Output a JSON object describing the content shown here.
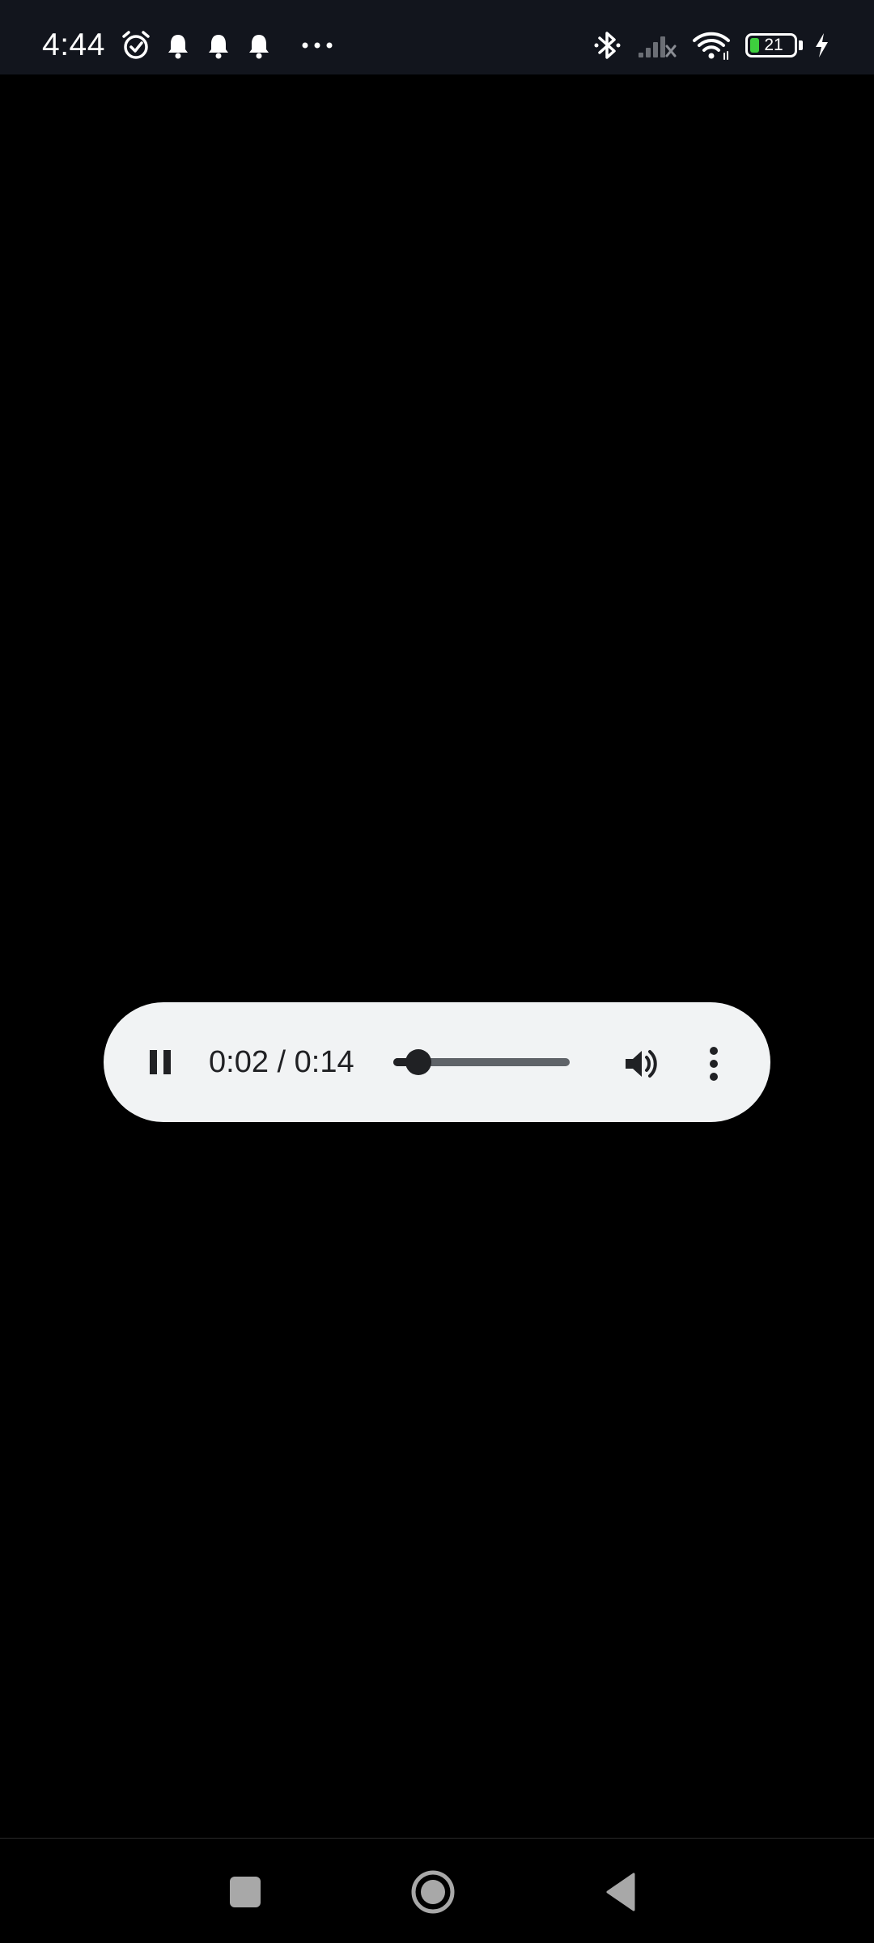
{
  "status_bar": {
    "time": "4:44",
    "left_icons": [
      "alarm-icon",
      "notification-bell-icon",
      "notification-bell-icon",
      "notification-bell-icon",
      "more-notifications-icon"
    ],
    "right_icons": [
      "bluetooth-icon",
      "cellular-no-signal-icon",
      "wifi-icon",
      "battery-icon",
      "charging-icon"
    ],
    "battery_level": "21",
    "battery_fraction": 0.21,
    "battery_color": "#3ecf3e"
  },
  "player": {
    "state": "playing",
    "time_display": "0:02 / 0:14",
    "progress_fraction": 0.143,
    "background_color": "#f1f3f4",
    "controls": [
      "pause-icon",
      "volume-icon",
      "more-options-icon"
    ]
  },
  "nav_bar": {
    "buttons": [
      "recents-icon",
      "home-icon",
      "back-icon"
    ]
  }
}
